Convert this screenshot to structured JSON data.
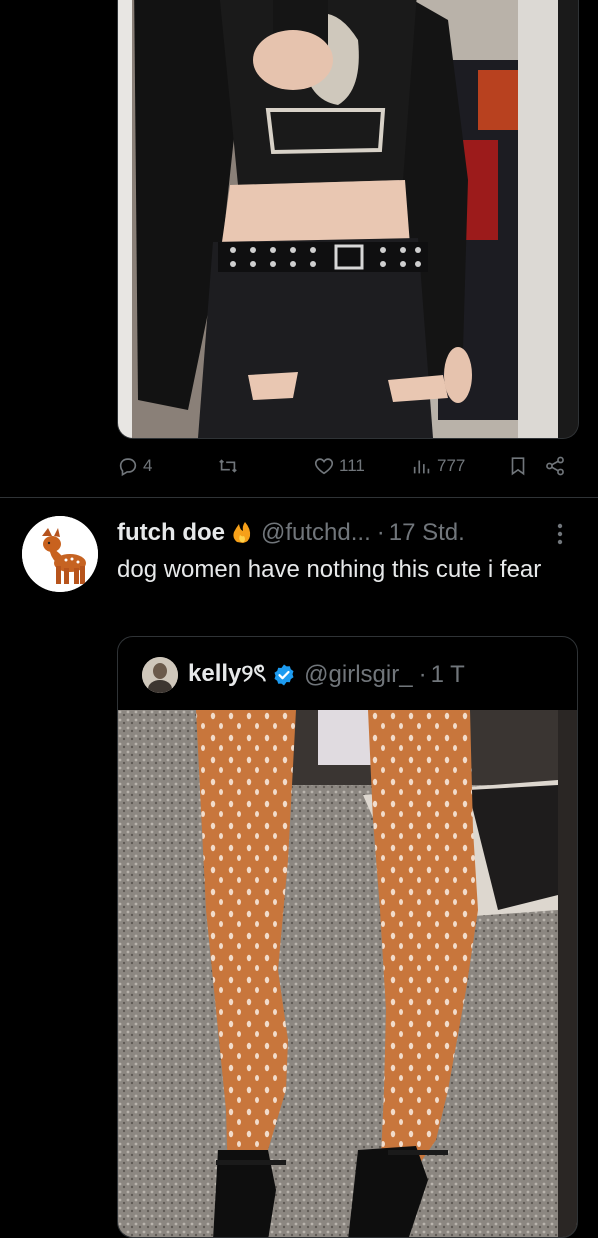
{
  "tweet_previous": {
    "media_alt_icon": "outfit-photo",
    "actions": {
      "reply_count": "4",
      "retweet_count": "",
      "like_count": "111",
      "views_count": "777"
    }
  },
  "tweet": {
    "display_name": "futch doe",
    "badge_icon": "fire-emoji-icon",
    "handle": "@futchd...",
    "separator": "·",
    "time": "17 Std.",
    "text": "dog women have nothing this cute i fear",
    "quote": {
      "display_name": "kelly୨ৎ",
      "verified_icon": "verified-badge-icon",
      "handle": "@girlsgir_",
      "separator": "·",
      "time": "1 T"
    }
  },
  "colors": {
    "background": "#000000",
    "text_primary": "#e7e9ea",
    "text_secondary": "#71767b",
    "border": "#2f3336",
    "verified_blue": "#1d9bf0"
  }
}
